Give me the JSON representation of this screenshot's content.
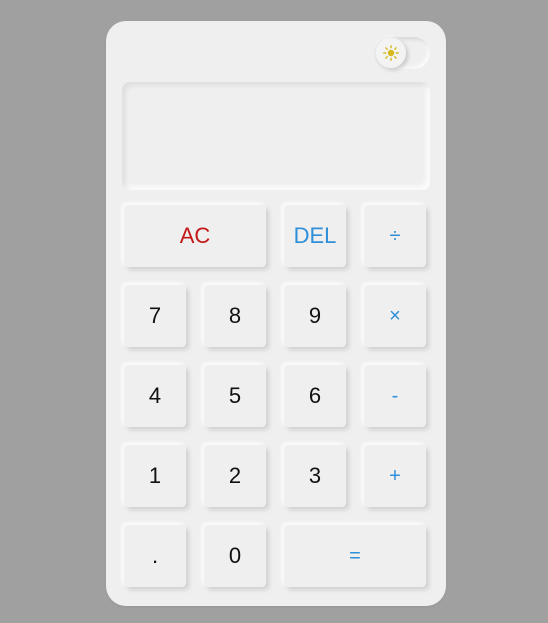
{
  "theme_toggle": {
    "icon": "sun-icon",
    "icon_color": "#d4b81c"
  },
  "display": {
    "value": ""
  },
  "colors": {
    "operator": "#2f8fd8",
    "clear": "#c21818",
    "digit": "#111111",
    "panel": "#efefef",
    "background": "#a0a0a0"
  },
  "keys": {
    "ac": "AC",
    "del": "DEL",
    "divide": "÷",
    "seven": "7",
    "eight": "8",
    "nine": "9",
    "multiply": "×",
    "four": "4",
    "five": "5",
    "six": "6",
    "minus": "-",
    "one": "1",
    "two": "2",
    "three": "3",
    "plus": "+",
    "dot": ".",
    "zero": "0",
    "equals": "="
  }
}
